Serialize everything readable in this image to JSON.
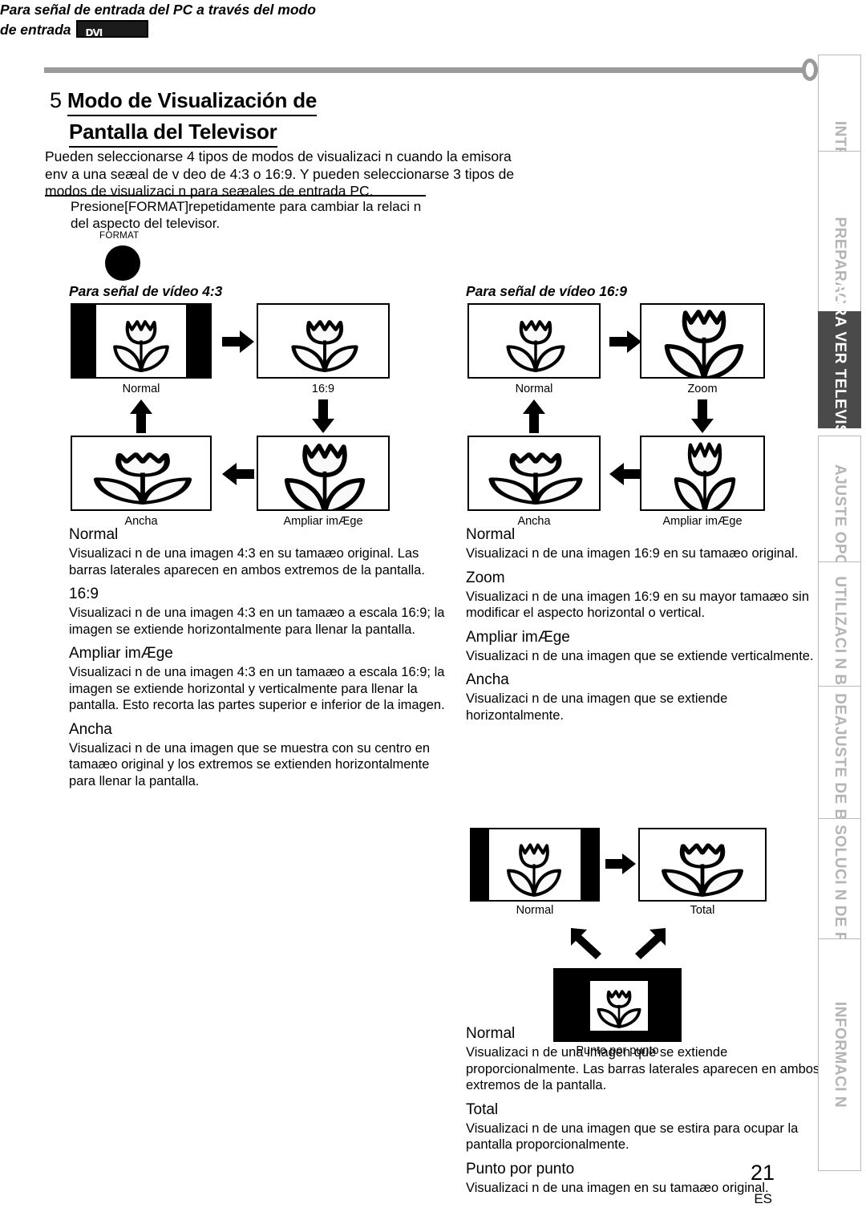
{
  "document": {
    "page_number": "21",
    "language_code": "ES"
  },
  "header": {
    "section_number": "5",
    "title_line1": "Modo de Visualización de",
    "title_line2": "Pantalla del Televisor",
    "intro": "Pueden seleccionarse 4 tipos de modos de visualizaci n cuando la emisora env a una seæal de v deo de 4:3 o 16:9. Y pueden seleccionarse 3 tipos de modos de visualizaci n para seæales de entrada PC."
  },
  "press_format": {
    "instruction": "Presione[FORMAT]repetidamente para cambiar la relaci n del aspecto del televisor.",
    "button_label": "FORMAT"
  },
  "diagrams": {
    "video_43": {
      "heading": "Para señal de vídeo 4:3",
      "captions": {
        "top_left": "Normal",
        "top_right": "16:9",
        "bottom_left": "Ancha",
        "bottom_right": "Ampliar imÆge"
      }
    },
    "video_169": {
      "heading": "Para señal de vídeo 16:9",
      "captions": {
        "top_left": "Normal",
        "top_right": "Zoom",
        "bottom_left": "Ancha",
        "bottom_right": "Ampliar imÆge"
      }
    },
    "pc_input": {
      "heading_line1": "Para señal de entrada del PC a través del modo",
      "heading_line2": "de entrada",
      "badge_glyph": "DVI",
      "captions": {
        "top_left": "Normal",
        "top_right": "Total",
        "bottom_center": "Punto por punto"
      }
    }
  },
  "modes_43": [
    {
      "term": "Normal",
      "desc": "Visualizaci n de una imagen 4:3 en su tamaæo original. Las barras laterales aparecen en ambos extremos de la pantalla."
    },
    {
      "term": "16:9",
      "desc": "Visualizaci n de una imagen 4:3 en un tamaæo a escala 16:9; la imagen se extiende horizontalmente para llenar la pantalla."
    },
    {
      "term": "Ampliar imÆge",
      "desc": "Visualizaci n de una imagen 4:3 en un tamaæo a escala 16:9; la imagen se extiende horizontal y verticalmente para llenar la pantalla. Esto recorta las partes superior e inferior de la imagen."
    },
    {
      "term": "Ancha",
      "desc": "Visualizaci n de una imagen que se muestra con su centro en tamaæo original y los extremos se extienden horizontalmente para llenar la pantalla."
    }
  ],
  "modes_169": [
    {
      "term": "Normal",
      "desc": "Visualizaci n de una imagen 16:9 en su tamaæo original."
    },
    {
      "term": "Zoom",
      "desc": "Visualizaci n de una imagen 16:9 en su mayor tamaæo sin modificar el aspecto horizontal o vertical."
    },
    {
      "term": "Ampliar imÆge",
      "desc": "Visualizaci n de una imagen que se extiende verticalmente."
    },
    {
      "term": "Ancha",
      "desc": "Visualizaci n de una imagen que se extiende horizontalmente."
    }
  ],
  "modes_pc": [
    {
      "term": "Normal",
      "desc": "Visualizaci n de una imagen que se extiende proporcionalmente. Las barras laterales aparecen en ambos extremos de la pantalla."
    },
    {
      "term": "Total",
      "desc": "Visualizaci n de una imagen que se estira para ocupar la pantalla proporcionalmente."
    },
    {
      "term": "Punto por punto",
      "desc": "Visualizaci n de una imagen en su tamaæo original."
    }
  ],
  "side_tabs": [
    {
      "label": "INTRODUCCI N",
      "active": false
    },
    {
      "label": "PREPARACI N",
      "active": false
    },
    {
      "label": "PARA VER TELEVISI N",
      "active": true
    },
    {
      "label": "AJUSTE OPCIONAL",
      "active": false
    },
    {
      "label": "UTILIZACI N BLU-RAY",
      "active": false
    },
    {
      "label": "DEAJUSTE DE BLU-RAY",
      "active": false
    },
    {
      "label": "SOLUCI N DE PROBLEMAS",
      "active": false
    },
    {
      "label": "INFORMACI N",
      "active": false
    }
  ],
  "colors": {
    "rule": "#9a9a9a",
    "active_tab_bg": "#4a4a4a",
    "inactive_tab_text": "#b4b4b4",
    "ink": "#000000"
  }
}
